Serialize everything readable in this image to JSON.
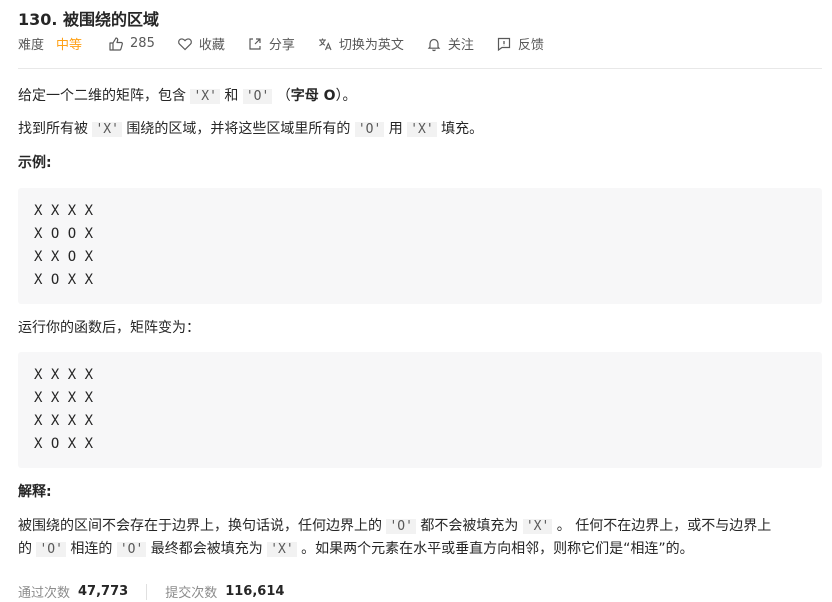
{
  "problem": {
    "title": "130. 被围绕的区域",
    "difficulty_label": "难度",
    "difficulty_value": "中等",
    "likes": "285",
    "actions": {
      "favorite": "收藏",
      "share": "分享",
      "switch_lang": "切换为英文",
      "follow": "关注",
      "feedback": "反馈"
    }
  },
  "description": {
    "p1": {
      "a": "给定一个二维的矩阵，包含",
      "x": "'X'",
      "b": "和",
      "o": "'O'",
      "c": "（",
      "bold": "字母 O",
      "d": "）。"
    },
    "p2": {
      "a": "找到所有被",
      "x": "'X'",
      "b": "围绕的区域，并将这些区域里所有的",
      "o": "'O'",
      "c": "用",
      "x2": "'X'",
      "d": "填充。"
    },
    "example_label": "示例:",
    "grid_before": [
      "X X X X",
      "X O O X",
      "X X O X",
      "X O X X"
    ],
    "after_text": "运行你的函数后，矩阵变为：",
    "grid_after": [
      "X X X X",
      "X X X X",
      "X X X X",
      "X O X X"
    ],
    "explain_label": "解释:",
    "explain": {
      "l1a": "被围绕的区间不会存在于边界上，换句话说，任何边界上的",
      "o1": "'O'",
      "l1b": "都不会被填充为",
      "x1": "'X'",
      "l1c": "。 任何不在边界上，或不与边界上",
      "l2a": "的",
      "o2": "'O'",
      "l2b": "相连的",
      "o3": "'O'",
      "l2c": "最终都会被填充为",
      "x2": "'X'",
      "l2d": "。如果两个元素在水平或垂直方向相邻，则称它们是“相连”的。"
    }
  },
  "stats": {
    "pass_label": "通过次数",
    "pass_value": "47,773",
    "submit_label": "提交次数",
    "submit_value": "116,614"
  }
}
